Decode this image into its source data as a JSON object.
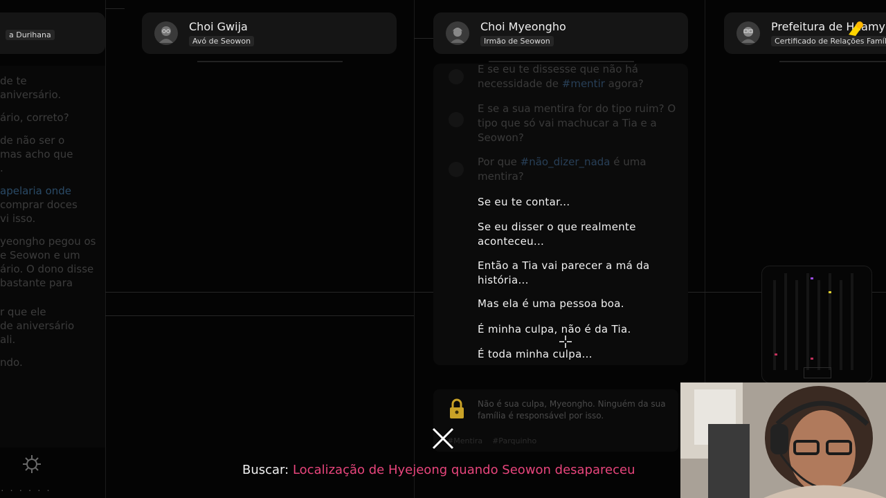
{
  "cards": [
    {
      "name": "",
      "badge": "a Durihana"
    },
    {
      "name": "Choi Gwija",
      "badge": "Avó de Seowon"
    },
    {
      "name": "Choi Myeongho",
      "badge": "Irmão de Seowon"
    },
    {
      "name": "Prefeitura de Haamye",
      "badge": "Certificado de Relações Família"
    }
  ],
  "left_column": [
    [
      "de te",
      "aniversário."
    ],
    [
      "ário, correto?"
    ],
    [
      "de não ser o",
      "mas acho que",
      "."
    ],
    [
      "apelaria onde",
      "comprar doces",
      "vi isso."
    ],
    [
      "yeongho pegou os",
      "e Seowon e um",
      "ário. O dono disse",
      "bastante para"
    ],
    [
      "r que ele",
      "de aniversário",
      " ali."
    ],
    [
      "ndo."
    ]
  ],
  "chat_faded": [
    {
      "pre": "E se eu te dissesse que não há necessidade de ",
      "tag": "#mentir",
      "post": " agora?"
    },
    {
      "pre": "E se a sua mentira for do tipo ruim? O tipo que só vai machucar a Tia e a Seowon?",
      "tag": "",
      "post": ""
    },
    {
      "pre": "Por que ",
      "tag": "#não_dizer_nada",
      "post": " é uma mentira?"
    }
  ],
  "chat_lines": [
    "Se eu te contar...",
    "Se eu disser o que realmente aconteceu...",
    "Então a Tia vai parecer a má da história...",
    "Mas ela é uma pessoa boa.",
    "É minha culpa, não é da Tia.",
    "É toda minha culpa..."
  ],
  "bottom_message": "Não é sua culpa, Myeongho. Ninguém da sua família é responsável por isso.",
  "bottom_tags": [
    "#Mentira",
    "#Parquinho"
  ],
  "search": {
    "label": "Buscar:",
    "query": "Localização de Hyejeong quando Seowon desapareceu"
  },
  "colors": {
    "accent_pink": "#e8457c",
    "tag_blue": "#2a4a66",
    "lock_gold": "#c9a227",
    "sticker_yellow": "#ffd400"
  },
  "icons": [
    "avatar-icon",
    "lock-icon",
    "gear-icon",
    "close-x-cursor-icon",
    "crosshair-icon"
  ]
}
